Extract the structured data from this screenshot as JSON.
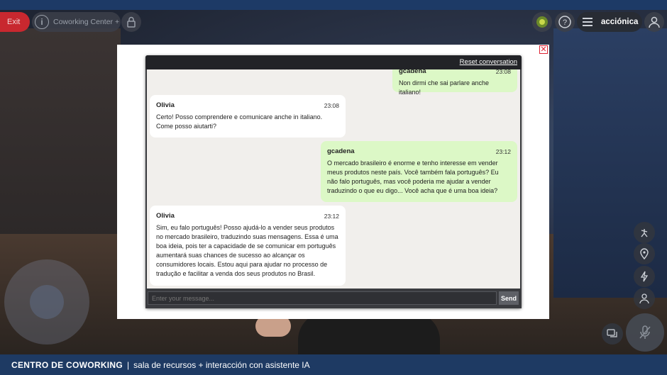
{
  "topbar": {
    "exit_label": "Exit",
    "room_name": "Coworking Center +",
    "brand": "acciónica"
  },
  "chat": {
    "reset_label": "Reset conversation",
    "input_placeholder": "Enter your message...",
    "send_label": "Send",
    "messages": [
      {
        "sender": "gcadena",
        "time": "23:08",
        "text": "Non dirmi che sai parlare anche italiano!",
        "role": "user"
      },
      {
        "sender": "Olivia",
        "time": "23:08",
        "text": "Certo! Posso comprendere e comunicare anche in italiano. Come posso aiutarti?",
        "role": "bot"
      },
      {
        "sender": "gcadena",
        "time": "23:12",
        "text": "O mercado brasileiro é enorme e tenho interesse em vender meus produtos neste país. Você também fala português? Eu não falo português, mas você poderia me ajudar a vender traduzindo o que eu digo... Você acha que é uma boa ideia?",
        "role": "user"
      },
      {
        "sender": "Olivia",
        "time": "23:12",
        "text": "Sim, eu falo português! Posso ajudá-lo a vender seus produtos no mercado brasileiro, traduzindo suas mensagens. Essa é uma boa ideia, pois ter a capacidade de se comunicar em português aumentará suas chances de sucesso ao alcançar os consumidores locais. Estou aqui para ajudar no processo de tradução e facilitar a venda dos seus produtos no Brasil.",
        "role": "bot"
      }
    ]
  },
  "caption": {
    "title": "CENTRO DE COWORKING",
    "separator": "|",
    "subtitle": "sala de recursos + interacción con asistente IA"
  },
  "colors": {
    "exit": "#c8282f",
    "user_bubble": "#dcf8c6",
    "bot_bubble": "#ffffff",
    "caption_bar": "#1e3a63"
  },
  "icons": [
    "info-icon",
    "lock-icon",
    "logo-icon",
    "help-icon",
    "menu-icon",
    "user-icon",
    "close-icon",
    "dance-icon",
    "location-icon",
    "lightning-icon",
    "people-icon",
    "chat-icon",
    "mic-off-icon"
  ]
}
